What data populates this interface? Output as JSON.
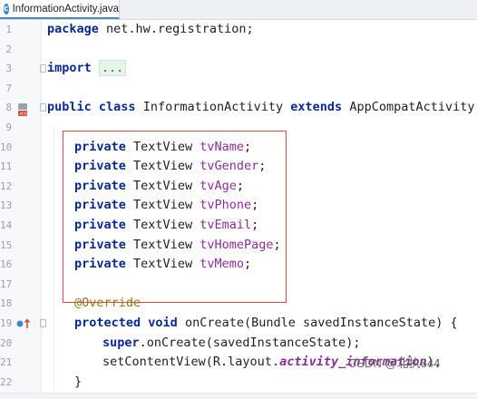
{
  "tab": {
    "icon": "c",
    "title": "InformationActivity.java"
  },
  "lines": [
    {
      "n": "1",
      "code": "package net.hw.registration;"
    },
    {
      "n": "2",
      "code": ""
    },
    {
      "n": "3",
      "kw": "import",
      "ellipsis": "..."
    },
    {
      "n": "7",
      "code": ""
    },
    {
      "n": "8",
      "kw1": "public class",
      "name": "InformationActivity",
      "kw2": "extends",
      "parent": "AppCompatActivity",
      "brace": "{"
    },
    {
      "n": "9",
      "code": ""
    },
    {
      "n": "10",
      "kw": "private",
      "type": "TextView",
      "field": "tvName",
      "end": ";"
    },
    {
      "n": "11",
      "kw": "private",
      "type": "TextView",
      "field": "tvGender",
      "end": ";"
    },
    {
      "n": "12",
      "kw": "private",
      "type": "TextView",
      "field": "tvAge",
      "end": ";"
    },
    {
      "n": "13",
      "kw": "private",
      "type": "TextView",
      "field": "tvPhone",
      "end": ";"
    },
    {
      "n": "14",
      "kw": "private",
      "type": "TextView",
      "field": "tvEmail",
      "end": ";"
    },
    {
      "n": "15",
      "kw": "private",
      "type": "TextView",
      "field": "tvHomePage",
      "end": ";"
    },
    {
      "n": "16",
      "kw": "private",
      "type": "TextView",
      "field": "tvMemo",
      "end": ";"
    },
    {
      "n": "17",
      "code": ""
    },
    {
      "n": "18",
      "ann": "@Override"
    },
    {
      "n": "19",
      "kw": "protected void",
      "rest": "onCreate(Bundle savedInstanceState) {"
    },
    {
      "n": "20",
      "kw": "super",
      "rest": ".onCreate(savedInstanceState);"
    },
    {
      "n": "21",
      "pre": "setContentView(R.layout.",
      "ifield": "activity_information",
      "post": ");"
    },
    {
      "n": "22",
      "code": "}"
    }
  ],
  "watermark": "CSDN @北执644"
}
